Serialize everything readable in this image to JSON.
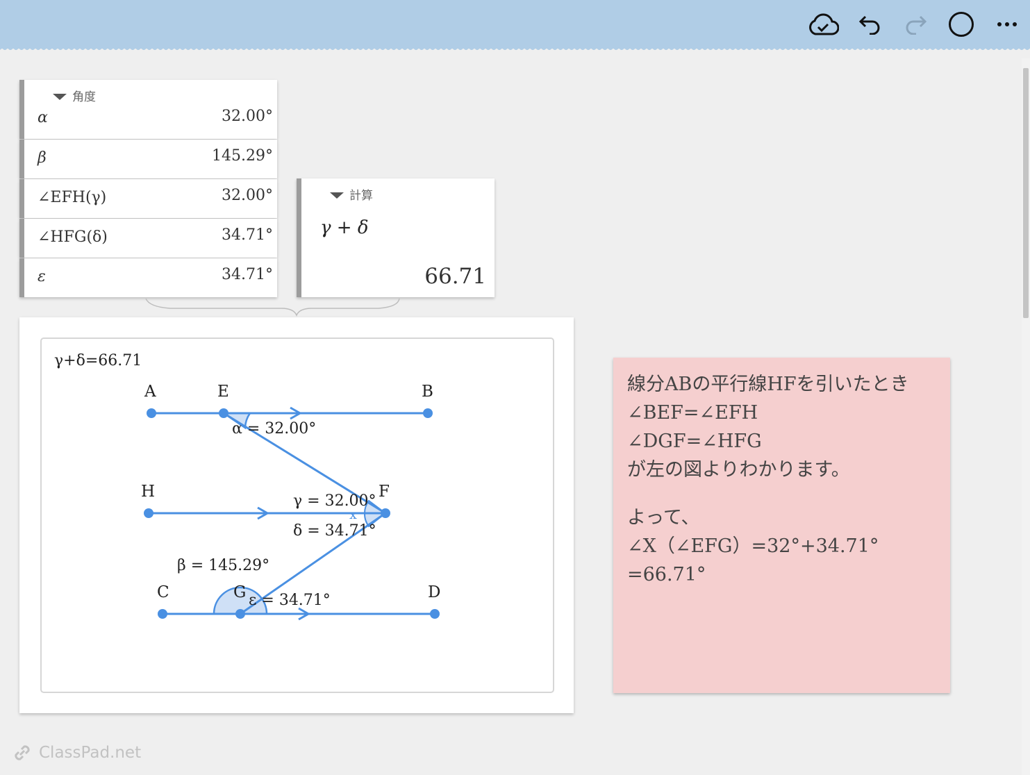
{
  "toolbar": {
    "cloud_icon": "cloud-check-icon",
    "undo_icon": "undo-icon",
    "redo_icon": "redo-icon",
    "circle_icon": "circle-icon",
    "more_icon": "more-icon"
  },
  "angles_card": {
    "heading": "角度",
    "rows": [
      {
        "label": "α",
        "value": "32.00°"
      },
      {
        "label": "β",
        "value": "145.29°"
      },
      {
        "label": "∠EFH(γ)",
        "value": "32.00°"
      },
      {
        "label": "∠HFG(δ)",
        "value": "34.71°"
      },
      {
        "label": "ε",
        "value": "34.71°"
      }
    ]
  },
  "calc_card": {
    "heading": "計算",
    "expression": "γ + δ",
    "result": "66.71"
  },
  "geometry": {
    "caption": "γ+δ=66.71",
    "points": {
      "A": "A",
      "E": "E",
      "B": "B",
      "H": "H",
      "F": "F",
      "C": "C",
      "G": "G",
      "D": "D"
    },
    "labels": {
      "alpha": "α = 32.00°",
      "gamma": "γ = 32.00°",
      "delta": "δ = 34.71°",
      "beta": "β = 145.29°",
      "epsilon": "ε = 34.71°",
      "x": "x"
    },
    "line_color": "#4a90e2",
    "arc_fill": "#cfe0f6"
  },
  "note": {
    "lines": [
      "線分ABの平行線HFを引いたとき",
      "∠BEF=∠EFH",
      "∠DGF=∠HFG",
      "が左の図よりわかります。"
    ],
    "lines2": [
      "よって、",
      "∠X（∠EFG）=32°+34.71°",
      "=66.71°"
    ],
    "background": "#f5cfcf"
  },
  "brand": {
    "name": "ClassPad.net",
    "icon": "link-icon"
  }
}
